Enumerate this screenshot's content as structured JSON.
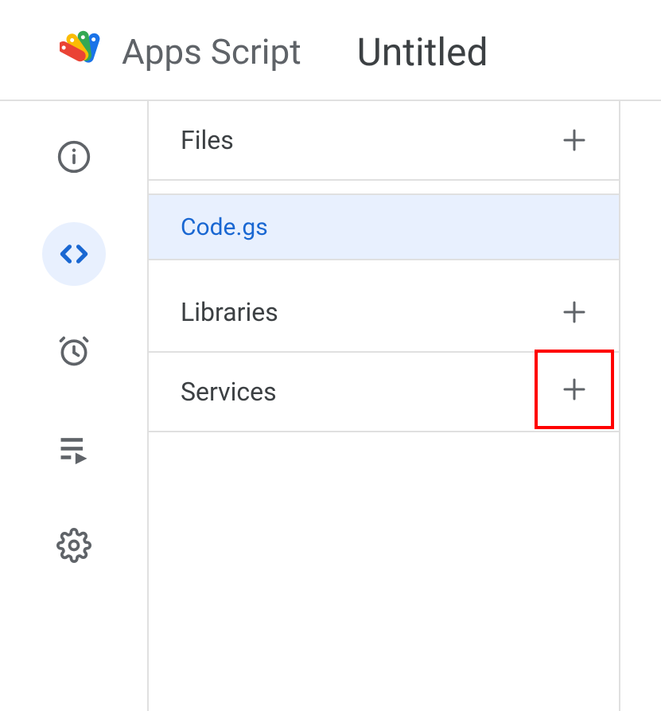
{
  "header": {
    "app_name": "Apps Script",
    "project_name": "Untitled"
  },
  "sidebar": {
    "sections": {
      "files": {
        "title": "Files",
        "items": [
          {
            "name": "Code.gs",
            "active": true
          }
        ]
      },
      "libraries": {
        "title": "Libraries"
      },
      "services": {
        "title": "Services"
      }
    }
  }
}
